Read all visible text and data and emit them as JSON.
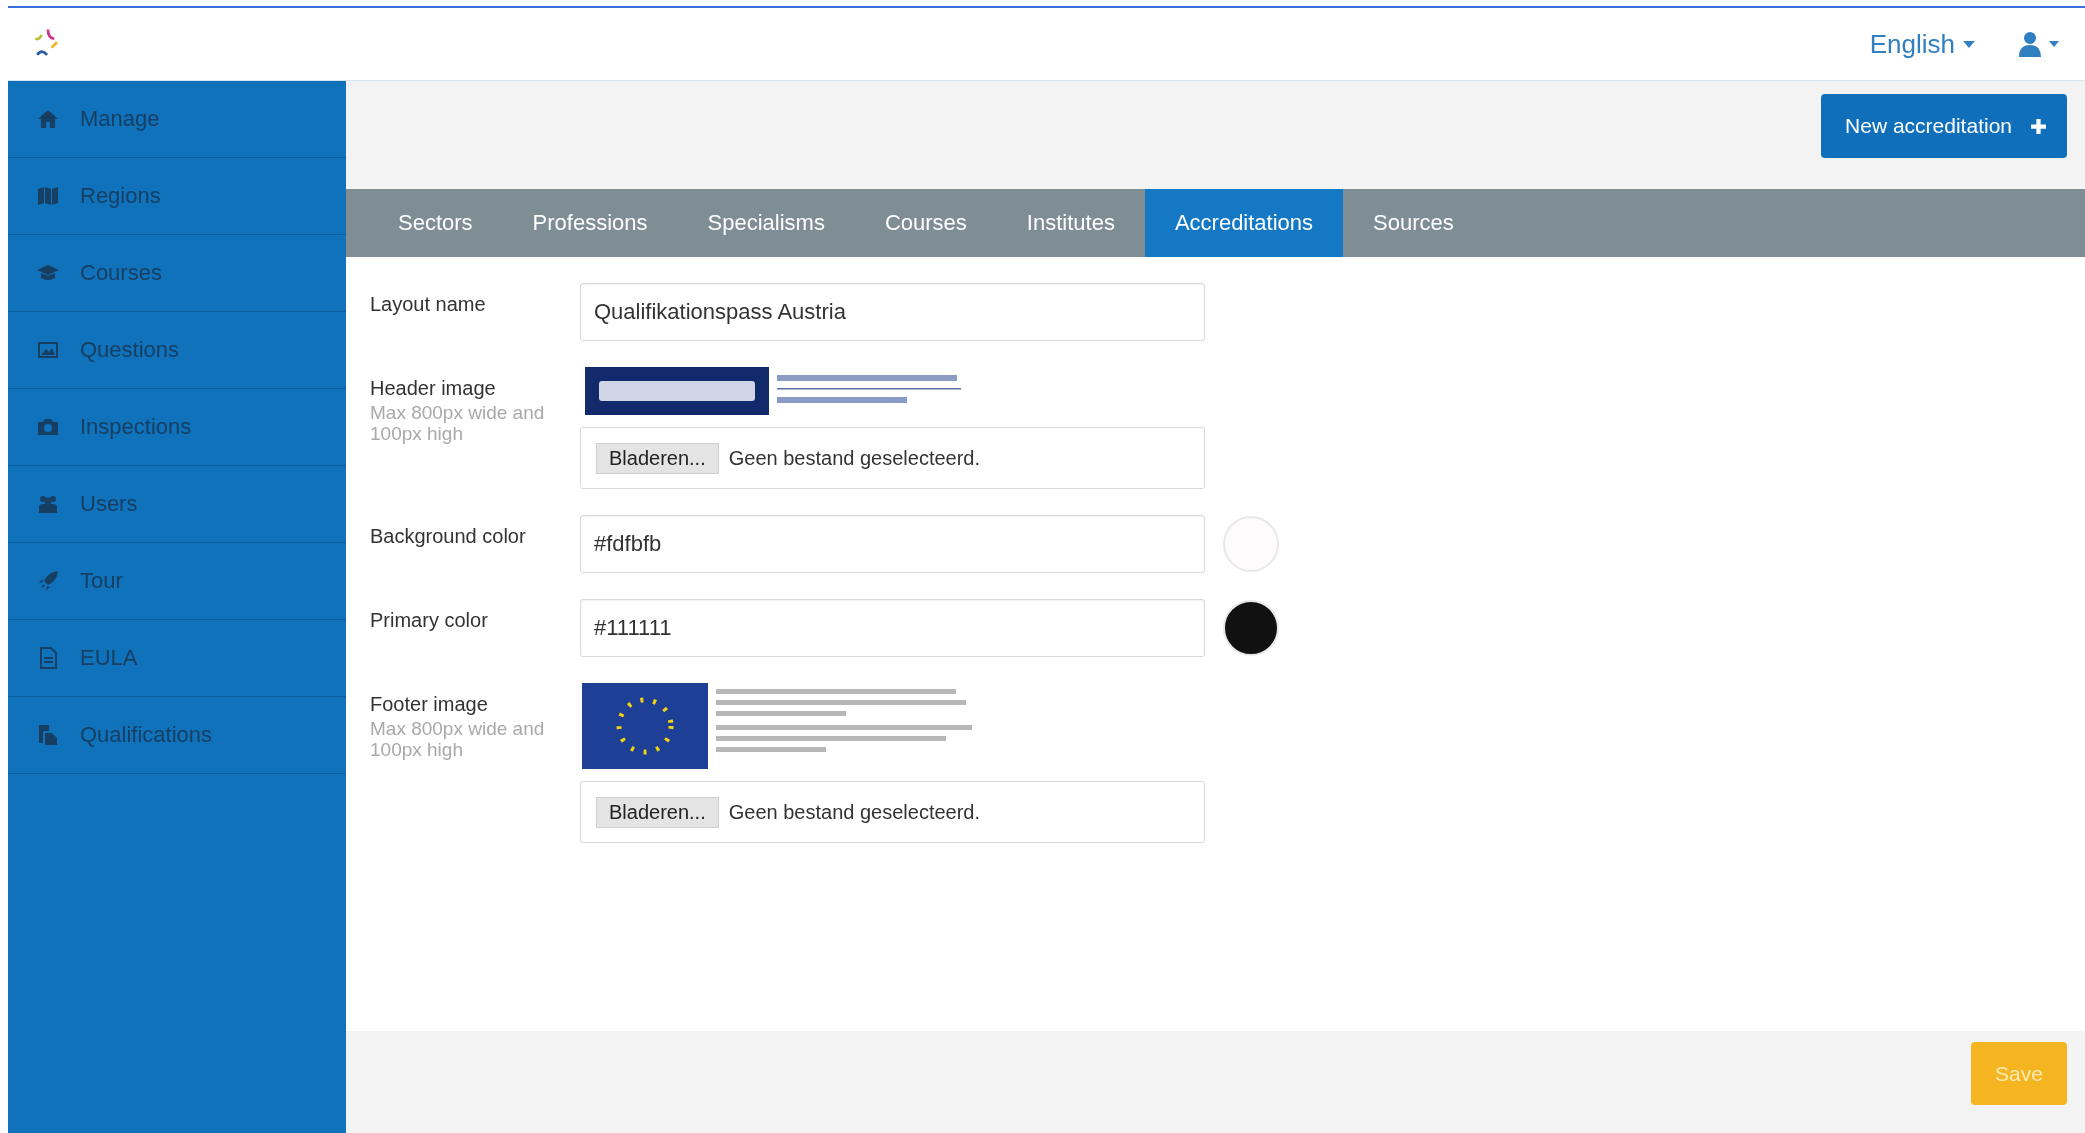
{
  "top_bar": {
    "language": "English"
  },
  "sidebar": {
    "items": [
      {
        "label": "Manage"
      },
      {
        "label": "Regions"
      },
      {
        "label": "Courses"
      },
      {
        "label": "Questions"
      },
      {
        "label": "Inspections"
      },
      {
        "label": "Users"
      },
      {
        "label": "Tour"
      },
      {
        "label": "EULA"
      },
      {
        "label": "Qualifications"
      }
    ]
  },
  "toolbar": {
    "new_button": "New accreditation"
  },
  "tabs": [
    {
      "label": "Sectors",
      "selected": false
    },
    {
      "label": "Professions",
      "selected": false
    },
    {
      "label": "Specialisms",
      "selected": false
    },
    {
      "label": "Courses",
      "selected": false
    },
    {
      "label": "Institutes",
      "selected": false
    },
    {
      "label": "Accreditations",
      "selected": true
    },
    {
      "label": "Sources",
      "selected": false
    }
  ],
  "form": {
    "fields": [
      {
        "kind": "text",
        "label": "Layout name",
        "value": "Qualifikationspass Austria"
      },
      {
        "kind": "file",
        "label": "Header image",
        "hint": "Max 800px wide and 100px high",
        "button": "Bladeren...",
        "status": "Geen bestand geselecteerd."
      },
      {
        "kind": "color",
        "label": "Background color",
        "value": "#fdfbfb"
      },
      {
        "kind": "color",
        "label": "Primary color",
        "value": "#111111"
      },
      {
        "kind": "file",
        "label": "Footer image",
        "hint": "Max 800px wide and 100px high",
        "button": "Bladeren...",
        "status": "Geen bestand geselecteerd."
      }
    ]
  },
  "footer": {
    "save_button": "Save"
  }
}
